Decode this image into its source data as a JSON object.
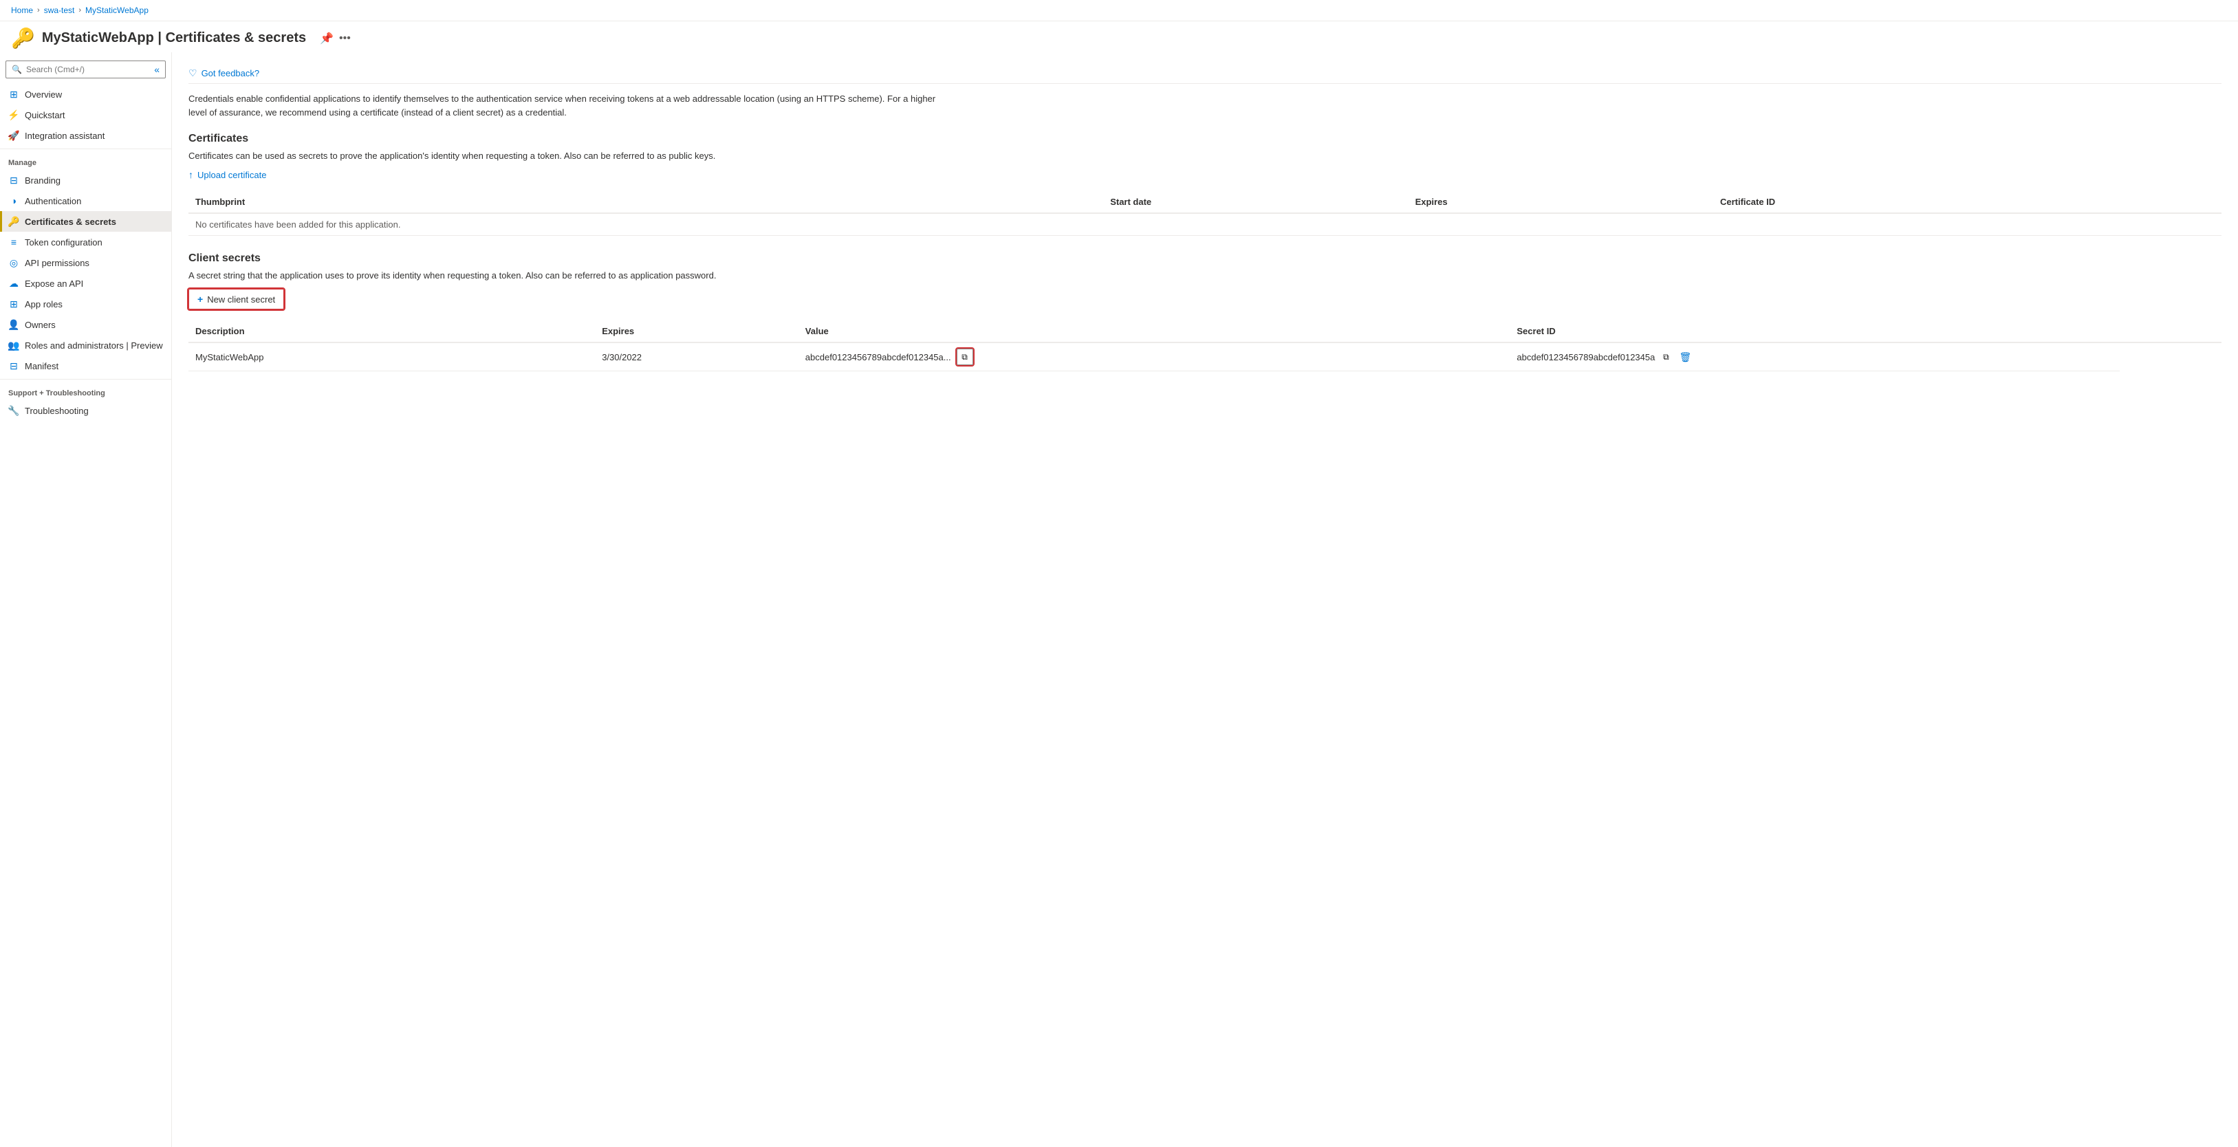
{
  "breadcrumb": {
    "home": "Home",
    "swa_test": "swa-test",
    "app": "MyStaticWebApp",
    "sep": "›"
  },
  "header": {
    "icon": "🔑",
    "title": "MyStaticWebApp | Certificates & secrets",
    "pin_icon": "📌",
    "more_icon": "..."
  },
  "sidebar": {
    "search_placeholder": "Search (Cmd+/)",
    "collapse_icon": "«",
    "items": [
      {
        "id": "overview",
        "label": "Overview",
        "icon": "⊞",
        "active": false
      },
      {
        "id": "quickstart",
        "label": "Quickstart",
        "icon": "⚡",
        "active": false
      },
      {
        "id": "integration",
        "label": "Integration assistant",
        "icon": "🚀",
        "active": false
      }
    ],
    "manage_label": "Manage",
    "manage_items": [
      {
        "id": "branding",
        "label": "Branding",
        "icon": "⊟",
        "active": false
      },
      {
        "id": "authentication",
        "label": "Authentication",
        "icon": "◑",
        "active": false
      },
      {
        "id": "certificates",
        "label": "Certificates & secrets",
        "icon": "🔑",
        "active": true
      },
      {
        "id": "token",
        "label": "Token configuration",
        "icon": "≡",
        "active": false
      },
      {
        "id": "api",
        "label": "API permissions",
        "icon": "◎",
        "active": false
      },
      {
        "id": "expose",
        "label": "Expose an API",
        "icon": "☁",
        "active": false
      },
      {
        "id": "approles",
        "label": "App roles",
        "icon": "⊞",
        "active": false
      },
      {
        "id": "owners",
        "label": "Owners",
        "icon": "👤",
        "active": false
      },
      {
        "id": "roles",
        "label": "Roles and administrators | Preview",
        "icon": "👥",
        "active": false
      },
      {
        "id": "manifest",
        "label": "Manifest",
        "icon": "⊟",
        "active": false
      }
    ],
    "support_label": "Support + Troubleshooting",
    "support_items": [
      {
        "id": "troubleshooting",
        "label": "Troubleshooting",
        "icon": "🔧",
        "active": false
      }
    ]
  },
  "content": {
    "feedback_label": "Got feedback?",
    "description": "Credentials enable confidential applications to identify themselves to the authentication service when receiving tokens at a web addressable location (using an HTTPS scheme). For a higher level of assurance, we recommend using a certificate (instead of a client secret) as a credential.",
    "certificates": {
      "title": "Certificates",
      "description": "Certificates can be used as secrets to prove the application's identity when requesting a token. Also can be referred to as public keys.",
      "upload_label": "Upload certificate",
      "table_headers": {
        "thumbprint": "Thumbprint",
        "start_date": "Start date",
        "expires": "Expires",
        "certificate_id": "Certificate ID"
      },
      "empty_message": "No certificates have been added for this application."
    },
    "client_secrets": {
      "title": "Client secrets",
      "description": "A secret string that the application uses to prove its identity when requesting a token. Also can be referred to as application password.",
      "new_secret_label": "New client secret",
      "table_headers": {
        "description": "Description",
        "expires": "Expires",
        "value": "Value",
        "secret_id": "Secret ID"
      },
      "rows": [
        {
          "description": "MyStaticWebApp",
          "expires": "3/30/2022",
          "value": "abcdef0123456789abcdef012345a...",
          "secret_id": "abcdef0123456789abcdef012345a"
        }
      ]
    }
  }
}
